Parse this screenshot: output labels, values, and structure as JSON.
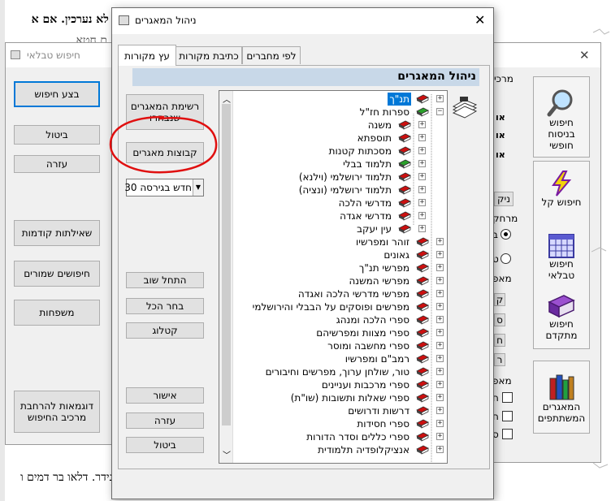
{
  "background_doc": {
    "line1": "בל לא נערכין. אם א",
    "line2": "ם חטא",
    "line_bottom": "א נידר. דלאו בר דמים ו",
    "right_letters": [
      "א",
      "מ"
    ]
  },
  "tabular_window": {
    "title": "חיפוש טבלאי",
    "buttons": [
      "בצע חיפוש",
      "ביטול",
      "עזרה",
      "שאילתות קודמות",
      "חיפושים שמורים",
      "משפחות",
      "דוגמאות להרחבת מרכיב החיפוש"
    ]
  },
  "search_window": {
    "labels": [
      "מרכי",
      "מרחק",
      "מאפ",
      "מאפ"
    ],
    "letters": [
      "או",
      "או",
      "או"
    ],
    "small_buttons": [
      "ניק",
      "ק",
      "ס",
      "ח",
      "ר"
    ],
    "radio_labels": [
      "ב",
      "ט"
    ],
    "check_labels": [
      "ח",
      "ח",
      "ס"
    ],
    "side_buttons": [
      {
        "label": "חיפוש בניסוח חופשי",
        "icon": "magnifier-icon"
      },
      {
        "label": "חיפוש קל",
        "icon": "lightning-icon"
      },
      {
        "label": "חיפוש טבלאי",
        "icon": "calendar-grid-icon"
      },
      {
        "label": "חיפוש מתקדם",
        "icon": "purple-book-icon"
      },
      {
        "label": "המאגרים המשתתפים",
        "icon": "books-icon"
      }
    ]
  },
  "dialog": {
    "title": "ניהול המאגרים",
    "close_label": "✕",
    "tabs": [
      "עץ מקורות",
      "כתיבת מקורות",
      "לפי מחברים"
    ],
    "panel_header": "ניהול המאגרים",
    "buttons": {
      "selected_list": "רשימת המאגרים שנבחרו",
      "groups": "קבוצות מאגרים",
      "restart": "התחל שוב",
      "select_all": "בחר הכל",
      "catalog": "קטלוג",
      "ok": "אישור",
      "help": "עזרה",
      "cancel": "ביטול"
    },
    "version_select": "חדש בגירסה 30",
    "tree": [
      {
        "label": "תנ\"ך",
        "level": 0,
        "color": "#cc1010",
        "box": "+",
        "selected": true
      },
      {
        "label": "ספרות חז\"ל",
        "level": 0,
        "color": "#2aa02a",
        "box": "−"
      },
      {
        "label": "משנה",
        "level": 1,
        "color": "#cc1010",
        "box": "+"
      },
      {
        "label": "תוספתא",
        "level": 1,
        "color": "#cc1010",
        "box": "+"
      },
      {
        "label": "מסכתות קטנות",
        "level": 1,
        "color": "#cc1010",
        "box": "+"
      },
      {
        "label": "תלמוד בבלי",
        "level": 1,
        "color": "#2aa02a",
        "box": "+"
      },
      {
        "label": "תלמוד ירושלמי (וילנא)",
        "level": 1,
        "color": "#cc1010",
        "box": "+"
      },
      {
        "label": "תלמוד ירושלמי (ונציה)",
        "level": 1,
        "color": "#cc1010",
        "box": "+"
      },
      {
        "label": "מדרשי הלכה",
        "level": 1,
        "color": "#cc1010",
        "box": "+"
      },
      {
        "label": "מדרשי אגדה",
        "level": 1,
        "color": "#cc1010",
        "box": "+"
      },
      {
        "label": "עין יעקב",
        "level": 1,
        "color": "#cc1010",
        "box": "+"
      },
      {
        "label": "זוהר ומפרשיו",
        "level": 0,
        "color": "#cc1010",
        "box": "+"
      },
      {
        "label": "גאונים",
        "level": 0,
        "color": "#cc1010",
        "box": "+"
      },
      {
        "label": "מפרשי תנ\"ך",
        "level": 0,
        "color": "#cc1010",
        "box": "+"
      },
      {
        "label": "מפרשי המשנה",
        "level": 0,
        "color": "#cc1010",
        "box": "+"
      },
      {
        "label": "מפרשי מדרשי הלכה ואגדה",
        "level": 0,
        "color": "#cc1010",
        "box": "+"
      },
      {
        "label": "מפרשים ופוסקים על הבבלי והירושלמי",
        "level": 0,
        "color": "#cc1010",
        "box": "+"
      },
      {
        "label": "ספרי הלכה ומנהג",
        "level": 0,
        "color": "#cc1010",
        "box": "+"
      },
      {
        "label": "ספרי מצוות ומפרשיהם",
        "level": 0,
        "color": "#cc1010",
        "box": "+"
      },
      {
        "label": "ספרי מחשבה ומוסר",
        "level": 0,
        "color": "#cc1010",
        "box": "+"
      },
      {
        "label": "רמב\"ם ומפרשיו",
        "level": 0,
        "color": "#cc1010",
        "box": "+"
      },
      {
        "label": "טור, שולחן ערוך, מפרשים וחיבורים",
        "level": 0,
        "color": "#cc1010",
        "box": "+"
      },
      {
        "label": "ספרי מרכבות ועניינים",
        "level": 0,
        "color": "#cc1010",
        "box": "+"
      },
      {
        "label": "ספרי שאלות ותשובות (שו\"ת)",
        "level": 0,
        "color": "#cc1010",
        "box": "+"
      },
      {
        "label": "דרשות ודרושים",
        "level": 0,
        "color": "#cc1010",
        "box": "+"
      },
      {
        "label": "ספרי חסידות",
        "level": 0,
        "color": "#cc1010",
        "box": "+"
      },
      {
        "label": "ספרי כללים וסדר הדורות",
        "level": 0,
        "color": "#cc1010",
        "box": "+"
      },
      {
        "label": "אנציקלופדיה תלמודית",
        "level": 0,
        "color": "#cc1010",
        "box": "+"
      }
    ]
  },
  "colors": {
    "header_bar": "#c8d8e8",
    "selection": "#0078d7",
    "annotation_circle": "#e01010"
  }
}
